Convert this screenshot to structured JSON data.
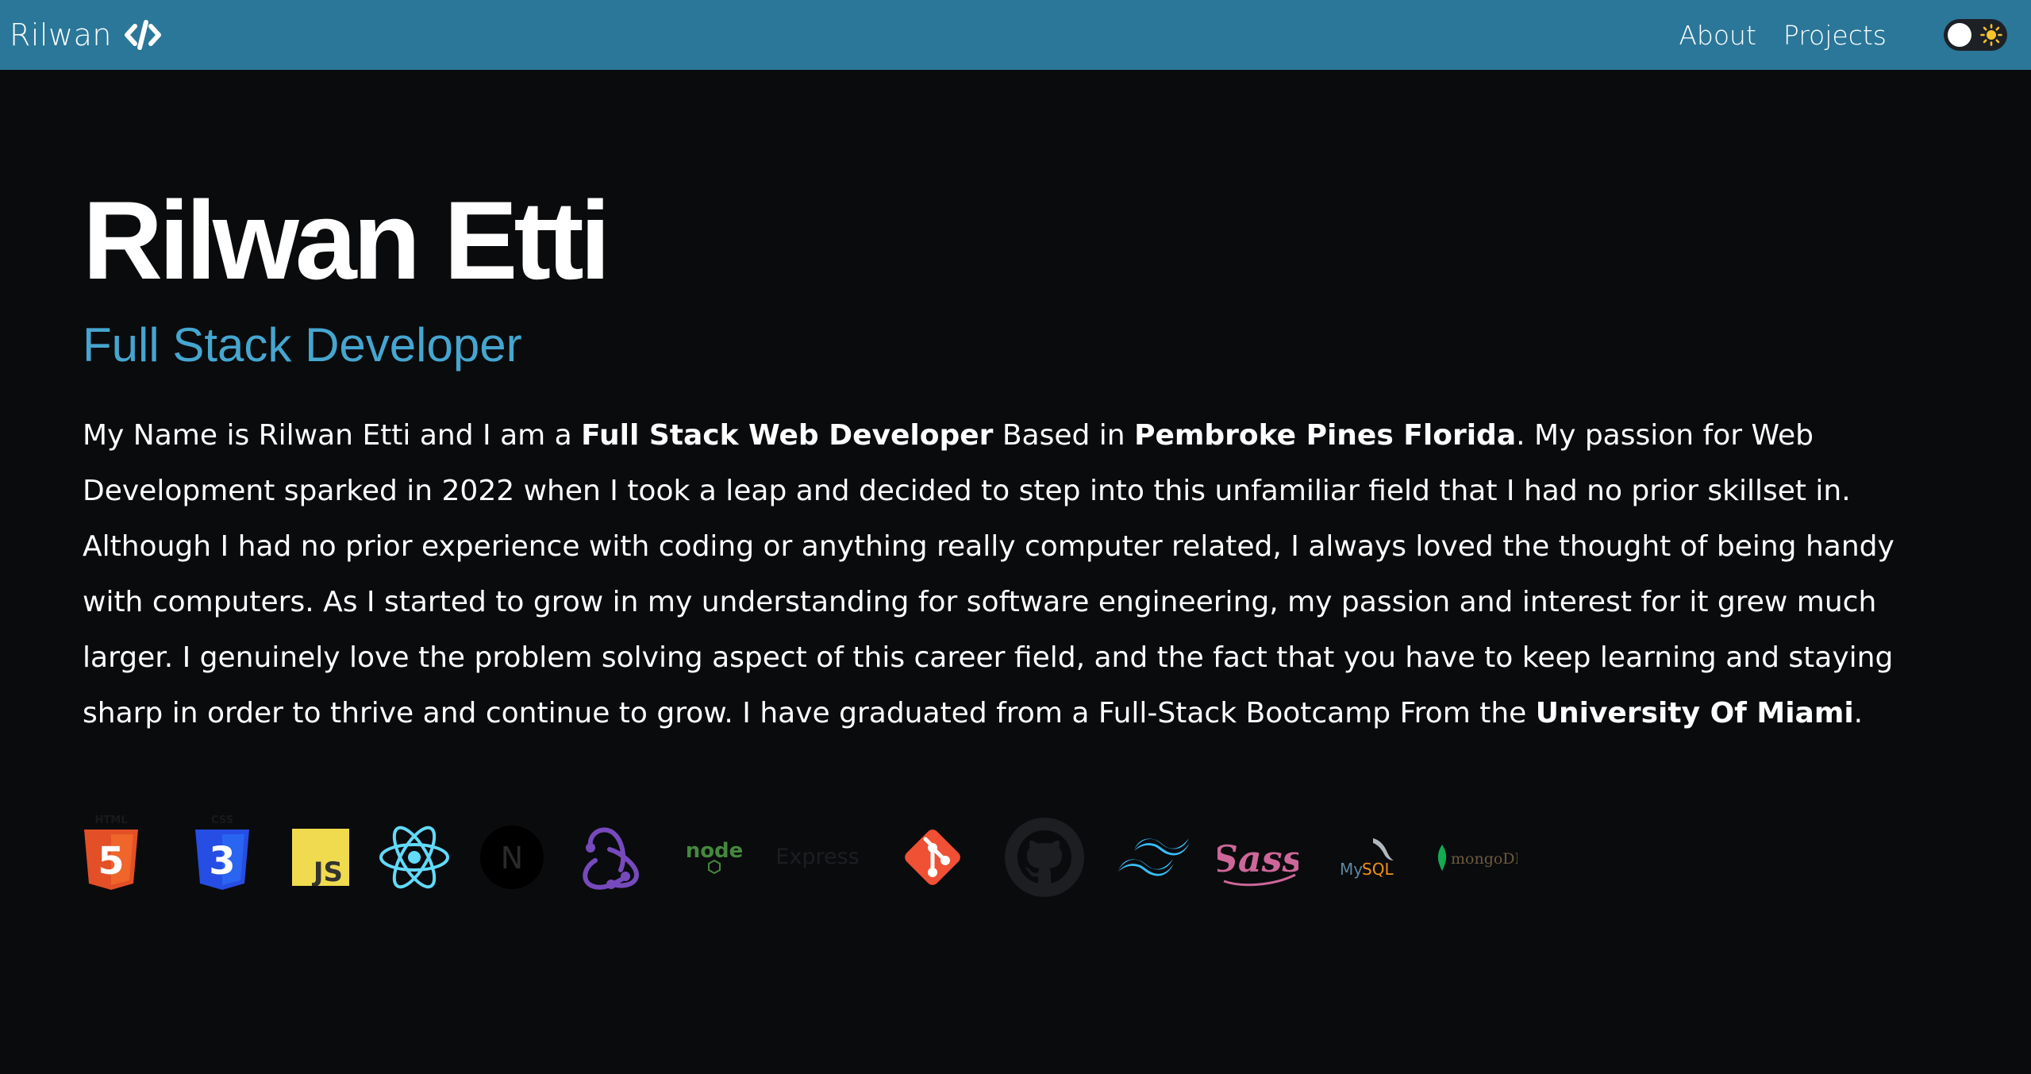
{
  "nav": {
    "brand": "Rilwan",
    "brand_icon": "code-slash-icon",
    "links": [
      "About",
      "Projects"
    ],
    "toggle_icon": "sun-icon"
  },
  "hero": {
    "name": "Rilwan Etti",
    "role": "Full Stack Developer",
    "bio": {
      "t1": "My Name is Rilwan Etti and I am a ",
      "b1": "Full Stack Web Developer",
      "t2": " Based in ",
      "b2": "Pembroke Pines Florida",
      "t3": ". My passion for Web Development sparked in 2022 when I took a leap and decided to step into this unfamiliar field that I had no prior skillset in. Although I had no prior experience with coding or anything really computer related, I always loved the thought of being handy with computers. As I started to grow in my understanding for software engineering, my passion and interest for it grew much larger. I genuinely love the problem solving aspect of this career field, and the fact that you have to keep learning and staying sharp in order to thrive and continue to grow. I have graduated from a Full-Stack Bootcamp From the ",
      "b3": "University Of Miami",
      "t4": "."
    }
  },
  "tech": {
    "html": {
      "label": "HTML",
      "glyph": "5",
      "icon": "html5-icon"
    },
    "css": {
      "label": "CSS",
      "glyph": "3",
      "icon": "css3-icon"
    },
    "js": {
      "label": "JS",
      "icon": "javascript-icon"
    },
    "react": {
      "icon": "react-icon"
    },
    "next": {
      "label": "N",
      "icon": "nextjs-icon"
    },
    "redux": {
      "icon": "redux-icon"
    },
    "node": {
      "label": "node",
      "icon": "nodejs-icon"
    },
    "express": {
      "label": "Express",
      "icon": "express-icon"
    },
    "git": {
      "icon": "git-icon"
    },
    "github": {
      "icon": "github-icon"
    },
    "tailwind": {
      "icon": "tailwind-icon"
    },
    "sass": {
      "label": "Sass",
      "icon": "sass-icon"
    },
    "mysql": {
      "label_a": "My",
      "label_b": "SQL",
      "icon": "mysql-icon"
    },
    "mongodb": {
      "label": "mongoDB",
      "icon": "mongodb-icon"
    }
  },
  "colors": {
    "navbar": "#2b7799",
    "background": "#0a0b0d",
    "accent": "#45a6cf"
  }
}
